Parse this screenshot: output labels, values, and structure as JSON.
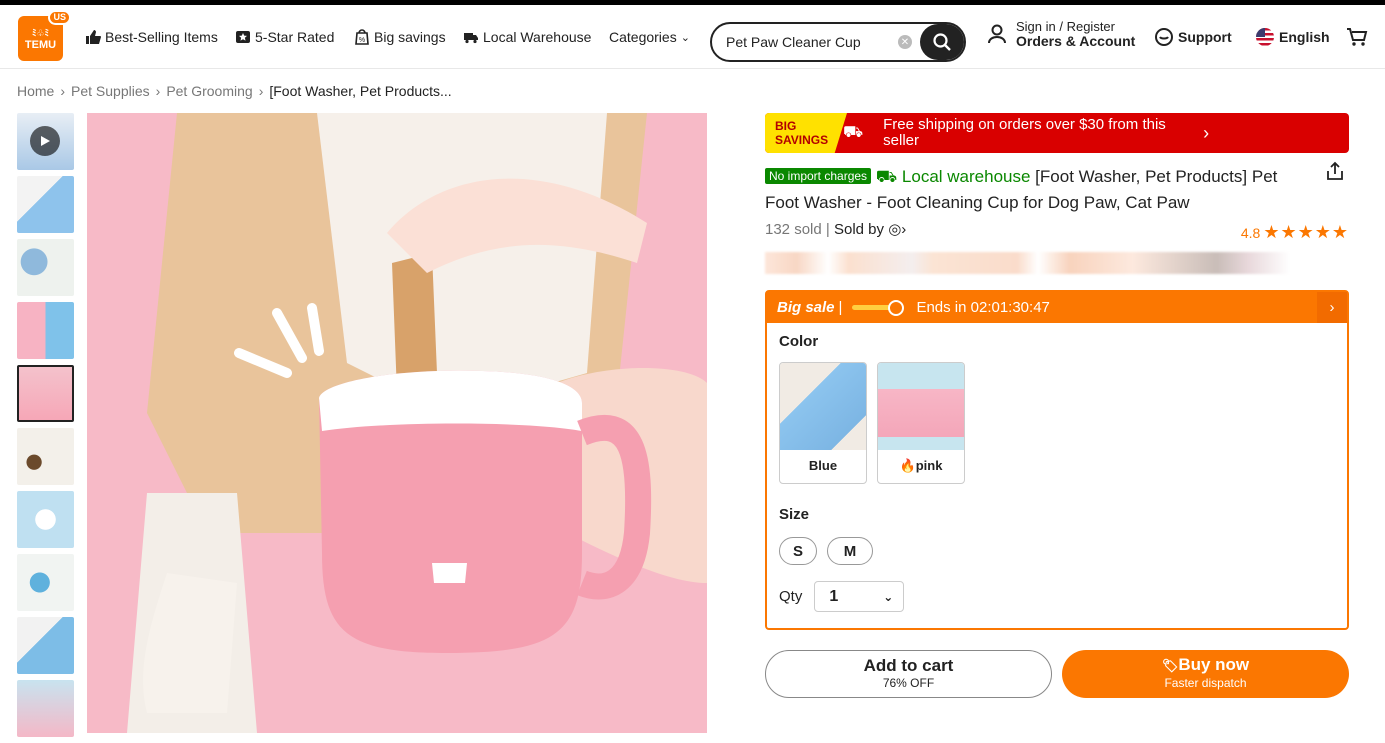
{
  "header": {
    "logo_text": "TEMU",
    "logo_region": "US",
    "nav": [
      "Best-Selling Items",
      "5-Star Rated",
      "Big savings",
      "Local Warehouse",
      "Categories"
    ],
    "search_value": "Pet Paw Cleaner Cup",
    "account_line1": "Sign in / Register",
    "account_line2": "Orders & Account",
    "support": "Support",
    "language": "English"
  },
  "breadcrumb": [
    "Home",
    "Pet Supplies",
    "Pet Grooming",
    "[Foot Washer, Pet Products..."
  ],
  "product": {
    "banner_tag": "BIG SAVINGS",
    "banner_msg": "Free shipping on orders over $30 from this seller",
    "badge": "No import charges",
    "local_warehouse": "Local warehouse",
    "title": "[Foot Washer, Pet Products] Pet Foot Washer - Foot Cleaning Cup for Dog Paw, Cat Paw",
    "sold": "132 sold",
    "sold_by": "Sold by",
    "rating": "4.8",
    "stars": "★★★★★",
    "sale_label": "Big sale",
    "sale_ends": "Ends in 02:01:30:47",
    "color_label": "Color",
    "colors": [
      "Blue",
      "pink"
    ],
    "size_label": "Size",
    "sizes": [
      "S",
      "M"
    ],
    "qty_label": "Qty",
    "qty_value": "1",
    "cart_label": "Add to cart",
    "cart_sub": "76% OFF",
    "buy_label": "Buy now",
    "buy_sub": "Faster dispatch"
  },
  "colors": {
    "accent": "#fb7701",
    "banner": "#d90000",
    "green": "#0a8800"
  }
}
